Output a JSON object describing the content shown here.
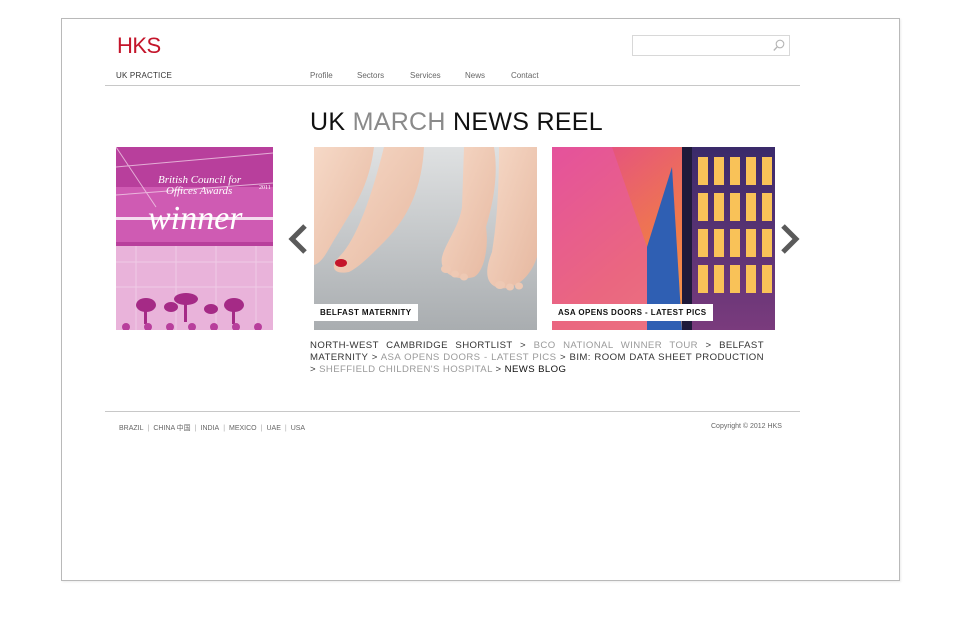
{
  "brand": {
    "logo": "HKS",
    "practice": "UK PRACTICE"
  },
  "search": {
    "value": "",
    "placeholder": "",
    "icon": "search-icon"
  },
  "nav": {
    "items": [
      "Profile",
      "Sectors",
      "Services",
      "News",
      "Contact"
    ]
  },
  "headline": {
    "part1": "UK",
    "part2": "MARCH",
    "part3": "NEWS REEL"
  },
  "carousel": {
    "prev_icon": "chevron-left-icon",
    "next_icon": "chevron-right-icon",
    "tiles": [
      {
        "name": "bco-award",
        "text_top": "British Council for",
        "text_mid": "Offices Awards",
        "year": "2011",
        "text_big": "winner"
      },
      {
        "name": "belfast-maternity",
        "caption": "BELFAST MATERNITY"
      },
      {
        "name": "asa-opens-doors",
        "caption": "ASA OPENS DOORS - LATEST PICS"
      }
    ]
  },
  "news_trail": {
    "items": [
      {
        "text": "NORTH-WEST CAMBRIDGE SHORTLIST",
        "tone": "dark"
      },
      {
        "text": "BCO NATIONAL WINNER TOUR",
        "tone": "light"
      },
      {
        "text": "BELFAST MATERNITY",
        "tone": "dark"
      },
      {
        "text": "ASA OPENS DOORS - LATEST PICS",
        "tone": "light"
      },
      {
        "text": "BIM: ROOM DATA SHEET PRODUCTION",
        "tone": "dark"
      },
      {
        "text": "SHEFFIELD CHILDREN'S HOSPITAL",
        "tone": "light"
      },
      {
        "text": "NEWS BLOG",
        "tone": "black"
      }
    ],
    "separator": ">"
  },
  "footer": {
    "offices": [
      "BRAZIL",
      "CHINA 中国",
      "INDIA",
      "MEXICO",
      "UAE",
      "USA"
    ],
    "copyright": "Copyright © 2012 HKS"
  },
  "colors": {
    "brand_red": "#c4152b",
    "magenta": "#c54aa6",
    "rule": "#c8c8c8"
  }
}
